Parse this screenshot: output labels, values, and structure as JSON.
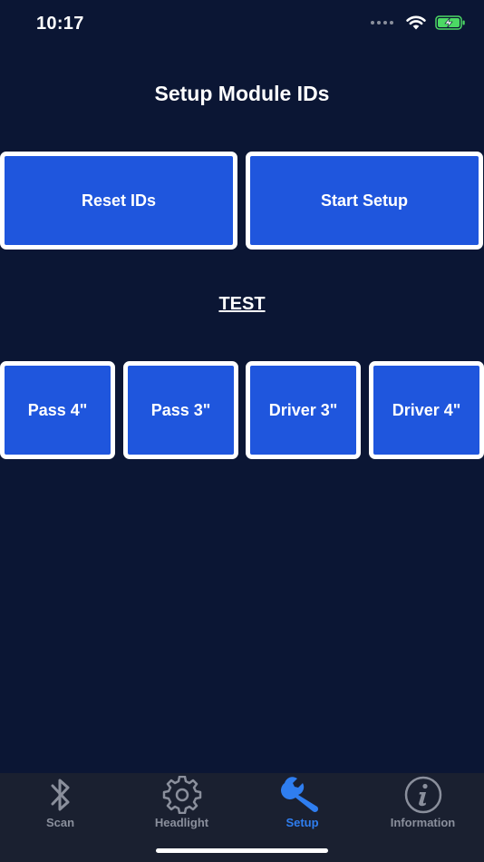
{
  "status_bar": {
    "time": "10:17",
    "icons": [
      "signal-dots-icon",
      "wifi-icon",
      "battery-charging-icon"
    ]
  },
  "page": {
    "title": "Setup Module IDs",
    "test_label": "TEST"
  },
  "buttons": {
    "reset_ids": "Reset IDs",
    "start_setup": "Start Setup"
  },
  "test_buttons": [
    "Pass 4\"",
    "Pass 3\"",
    "Driver 3\"",
    "Driver 4\""
  ],
  "tab_bar": {
    "tabs": [
      {
        "label": "Scan",
        "icon": "bluetooth-icon",
        "active": false
      },
      {
        "label": "Headlight",
        "icon": "gear-icon",
        "active": false
      },
      {
        "label": "Setup",
        "icon": "wrench-icon",
        "active": true
      },
      {
        "label": "Information",
        "icon": "info-icon",
        "active": false
      }
    ]
  },
  "colors": {
    "background": "#0b1634",
    "button": "#1f56dd",
    "button_border": "#ffffff",
    "tab_active": "#2f7ef0",
    "tab_inactive": "#8a8f9c",
    "battery": "#4cd964"
  }
}
